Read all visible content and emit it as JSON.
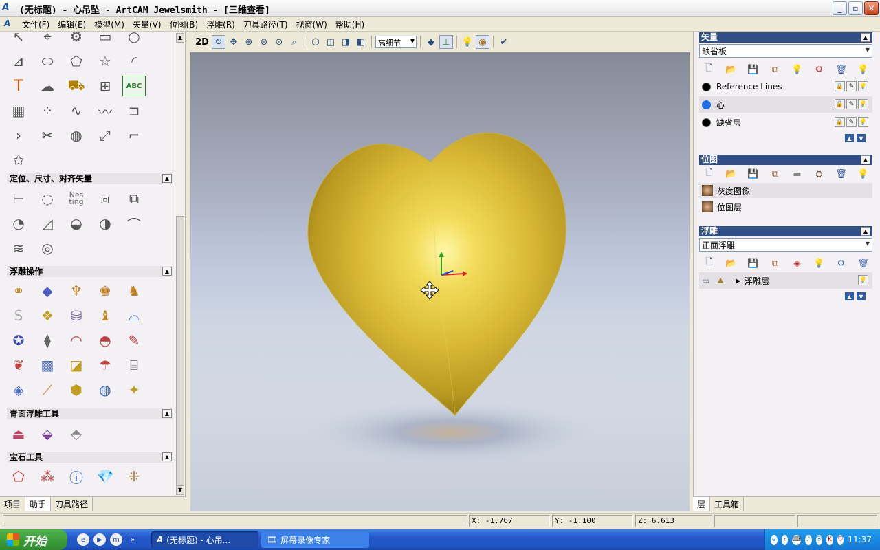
{
  "window": {
    "title": "(无标题) - 心吊坠 - ArtCAM Jewelsmith - [三维查看]",
    "logo": "A"
  },
  "menu": {
    "items": [
      "文件(F)",
      "编辑(E)",
      "模型(M)",
      "矢量(V)",
      "位图(B)",
      "浮雕(R)",
      "刀具路径(T)",
      "视窗(W)",
      "帮助(H)"
    ]
  },
  "left_panel": {
    "sections": {
      "position": "定位、尺寸、对齐矢量",
      "relief_ops": "浮雕操作",
      "bas_relief": "青面浮雕工具",
      "gem_tools": "宝石工具"
    },
    "nesting_label": "Nes ting",
    "abc_label": "ABC"
  },
  "left_tabs": [
    "项目",
    "助手",
    "刀具路径"
  ],
  "view_toolbar": {
    "mode_2d": "2D",
    "quality": "高细节"
  },
  "right_panel": {
    "vectors": {
      "title": "矢量",
      "combo": "缺省板",
      "layers": [
        {
          "name": "Reference Lines",
          "color": "#000000"
        },
        {
          "name": "心",
          "color": "#1e6fe8"
        },
        {
          "name": "缺省层",
          "color": "#000000"
        }
      ]
    },
    "bitmaps": {
      "title": "位图",
      "layers": [
        {
          "name": "灰度图像"
        },
        {
          "name": "位图层"
        }
      ]
    },
    "relief": {
      "title": "浮雕",
      "combo": "正面浮雕",
      "layer": "浮雕层"
    }
  },
  "right_tabs": [
    "层",
    "工具箱"
  ],
  "status": {
    "x": "X: -1.767",
    "y": "Y: -1.100",
    "z": "Z: 6.613"
  },
  "taskbar": {
    "start": "开始",
    "tasks": [
      "(无标题) - 心吊...",
      "屏幕录像专家"
    ],
    "clock": "11:37"
  },
  "colors": {
    "heart": "#e7c93d",
    "title_accent": "#2f4f86"
  }
}
